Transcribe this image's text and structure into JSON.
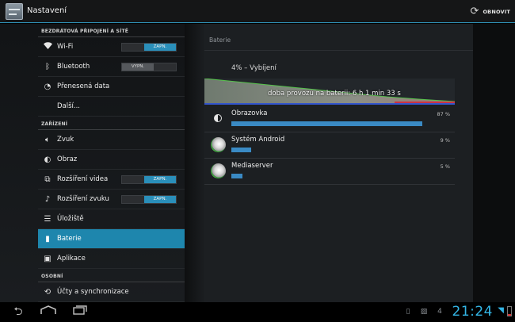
{
  "actionbar": {
    "title": "Nastavení",
    "refresh_label": "OBNOVIT"
  },
  "sidebar": {
    "sections": [
      {
        "header": "BEZDRÁTOVÁ PŘIPOJENÍ A SÍTĚ",
        "items": [
          {
            "label": "Wi-Fi",
            "icon": "wifi-icon",
            "toggle": "ZAPN."
          },
          {
            "label": "Bluetooth",
            "icon": "bluetooth-icon",
            "toggle": "VYPN."
          },
          {
            "label": "Přenesená data",
            "icon": "data-usage-icon"
          },
          {
            "label": "Další..."
          }
        ]
      },
      {
        "header": "ZAŘÍZENÍ",
        "items": [
          {
            "label": "Zvuk",
            "icon": "sound-icon"
          },
          {
            "label": "Obraz",
            "icon": "display-icon"
          },
          {
            "label": "Rozšíření videa",
            "icon": "video-enhance-icon",
            "toggle": "ZAPN."
          },
          {
            "label": "Rozšíření zvuku",
            "icon": "audio-enhance-icon",
            "toggle": "ZAPN."
          },
          {
            "label": "Úložiště",
            "icon": "storage-icon"
          },
          {
            "label": "Baterie",
            "icon": "battery-icon",
            "selected": true
          },
          {
            "label": "Aplikace",
            "icon": "apps-icon"
          }
        ]
      },
      {
        "header": "OSOBNÍ",
        "items": [
          {
            "label": "Účty a synchronizace",
            "icon": "sync-icon"
          }
        ]
      }
    ]
  },
  "battery": {
    "title": "Baterie",
    "status": "4% – Vybíjení",
    "graph_label": "doba provozu na baterii: 6 h 1 min 33 s",
    "usage": [
      {
        "name": "Obrazovka",
        "percent_label": "87 %",
        "fraction": 0.87,
        "icon": "screen-icon"
      },
      {
        "name": "Systém Android",
        "percent_label": "9 %",
        "fraction": 0.09,
        "icon": "android-system-icon"
      },
      {
        "name": "Mediaserver",
        "percent_label": "5 %",
        "fraction": 0.05,
        "icon": "mediaserver-icon"
      }
    ],
    "colors": {
      "accent": "#33b5e5",
      "bar": "#3a8ac4",
      "selected": "#1e86ad"
    }
  },
  "systembar": {
    "clock": "21:24",
    "notification_count": "4"
  }
}
